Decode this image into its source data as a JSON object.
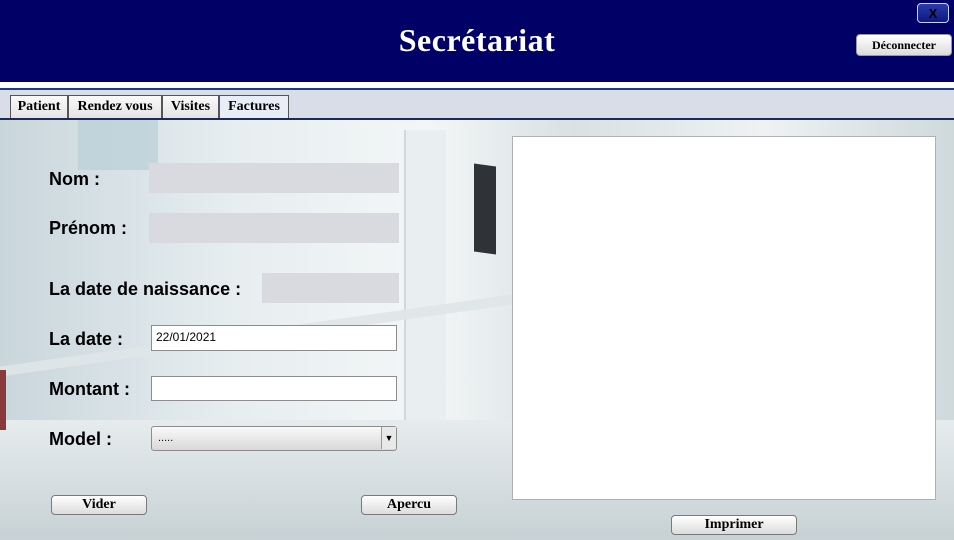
{
  "header": {
    "title": "Secrétariat",
    "close_label": "X",
    "disconnect_label": "Déconnecter",
    "background_color": "#000066"
  },
  "tabs": [
    {
      "label": "Patient",
      "active": false
    },
    {
      "label": "Rendez vous",
      "active": false
    },
    {
      "label": "Visites",
      "active": false
    },
    {
      "label": "Factures",
      "active": true
    }
  ],
  "form": {
    "nom_label": "Nom :",
    "nom_value": "",
    "prenom_label": "Prénom :",
    "prenom_value": "",
    "naissance_label": "La date de naissance :",
    "naissance_value": "",
    "date_label": "La date :",
    "date_value": "22/01/2021",
    "montant_label": "Montant :",
    "montant_value": "",
    "model_label": "Model :",
    "model_selected": "....."
  },
  "buttons": {
    "vider": "Vider",
    "apercu": "Apercu",
    "imprimer": "Imprimer"
  },
  "icons": {
    "dropdown": "chevron-down-icon",
    "close": "close-icon"
  }
}
